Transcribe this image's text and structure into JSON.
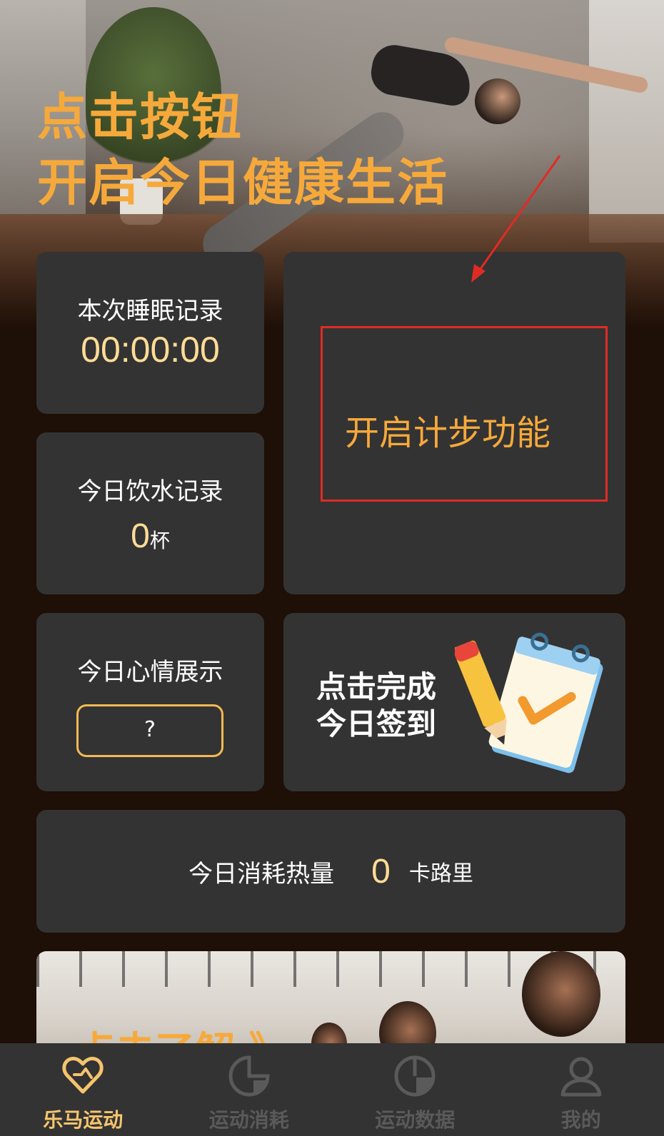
{
  "hero": {
    "title_line1": "点击按钮",
    "title_line2": "开启今日健康生活"
  },
  "cards": {
    "sleep": {
      "label": "本次睡眠记录",
      "value": "00:00:00"
    },
    "water": {
      "label": "今日饮水记录",
      "value": "0",
      "unit": "杯"
    },
    "step": {
      "label": "开启计步功能"
    },
    "mood": {
      "label": "今日心情展示",
      "button_text": "?"
    },
    "checkin": {
      "line1": "点击完成",
      "line2": "今日签到",
      "icon": "calendar-check-icon"
    },
    "calorie": {
      "label": "今日消耗热量",
      "value": "0",
      "unit": "卡路里"
    },
    "banner": {
      "text": "点击了解 》"
    }
  },
  "tabbar": {
    "items": [
      {
        "label": "乐马运动",
        "icon": "heart-icon",
        "active": true
      },
      {
        "label": "运动消耗",
        "icon": "chart-icon",
        "active": false
      },
      {
        "label": "运动数据",
        "icon": "pie-icon",
        "active": false
      },
      {
        "label": "我的",
        "icon": "user-icon",
        "active": false
      }
    ]
  },
  "colors": {
    "background": "#1e0f07",
    "card": "#333333",
    "accent": "#f6a93b",
    "value": "#fedc96",
    "highlight_box": "#e02b25",
    "tab_inactive": "#5a5a5a",
    "tab_active": "#f5c46d"
  }
}
